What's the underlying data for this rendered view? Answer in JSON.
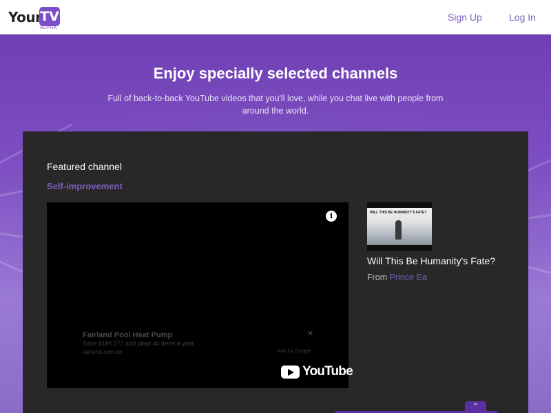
{
  "header": {
    "logo": {
      "your": "Your",
      "tv": "TV",
      "tag": "ALPHA"
    },
    "nav": {
      "signup": "Sign Up",
      "login": "Log In"
    }
  },
  "hero": {
    "title": "Enjoy specially selected channels",
    "subtitle": "Full of back-to-back YouTube videos that you'll love, while you chat live with people from around the world."
  },
  "featured": {
    "label": "Featured channel",
    "channel": "Self-improvement",
    "player": {
      "ad": {
        "title": "Fairland Pool Heat Pump",
        "text": "Save EUR 277 and plant 40 trees a year.",
        "url": "fairland.com.cn",
        "by": "Ads by Google",
        "close": "✕"
      },
      "info_icon": "i",
      "brand": "YouTube"
    },
    "next_video": {
      "thumb_caption": "WILL THIS BE HUMANITY'S FATE?",
      "title": "Will This Be Humanity's Fate?",
      "from_label": "From",
      "author": "Prince Ea"
    }
  },
  "scroll_top_icon": "^",
  "colors": {
    "brand_purple": "#7b4fc7",
    "link_purple": "#7b5fc0",
    "panel_bg": "#282828",
    "header_bg": "#ffffff"
  }
}
